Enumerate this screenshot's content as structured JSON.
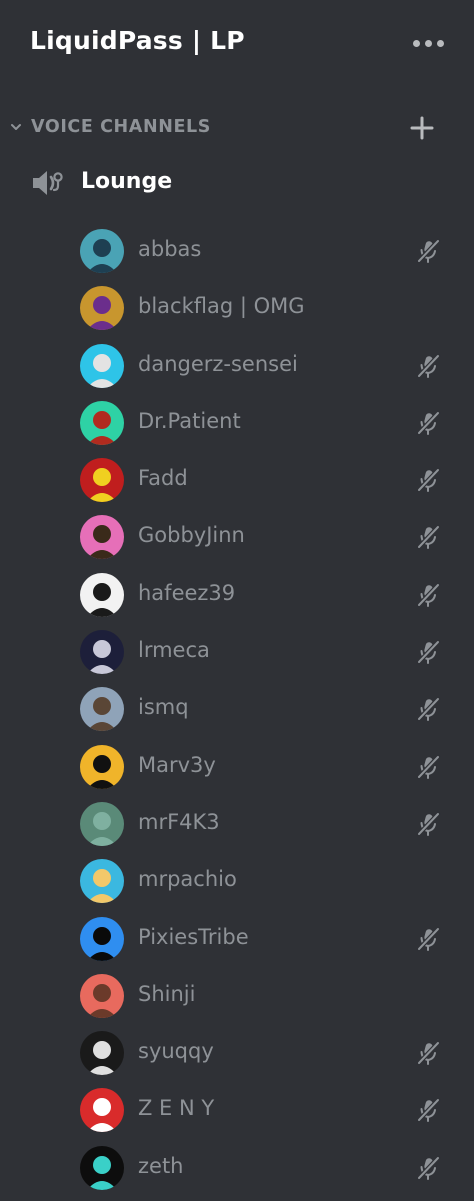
{
  "server": {
    "name": "LiquidPass | LP",
    "more_icon": "more-horizontal-icon"
  },
  "category": {
    "label": "VOICE CHANNELS",
    "collapse_icon": "chevron-down-icon",
    "add_icon": "plus-icon"
  },
  "channel": {
    "name": "Lounge",
    "icon": "speaker-icon"
  },
  "colors": {
    "background": "#2f3136",
    "title_text": "#ffffff",
    "muted_text": "#8e9297",
    "icon_gray": "#b9bbbe"
  },
  "members": [
    {
      "name": "abbas",
      "muted": true,
      "avatar_bg": "#4aa3b5",
      "avatar_fg": "#1e3f52"
    },
    {
      "name": "blackflag | OMG",
      "muted": false,
      "avatar_bg": "#c8962e",
      "avatar_fg": "#6b2e8c"
    },
    {
      "name": "dangerz-sensei",
      "muted": true,
      "avatar_bg": "#2ec4e8",
      "avatar_fg": "#e3e3e3"
    },
    {
      "name": "Dr.Patient",
      "muted": true,
      "avatar_bg": "#2ed2a5",
      "avatar_fg": "#b02b1f"
    },
    {
      "name": "Fadd",
      "muted": true,
      "avatar_bg": "#c01e1e",
      "avatar_fg": "#f0d020"
    },
    {
      "name": "GobbyJinn",
      "muted": true,
      "avatar_bg": "#e66fb8",
      "avatar_fg": "#3a2a1a"
    },
    {
      "name": "hafeez39",
      "muted": true,
      "avatar_bg": "#f2f2f2",
      "avatar_fg": "#1a1a1a"
    },
    {
      "name": "lrmeca",
      "muted": true,
      "avatar_bg": "#1d1f3a",
      "avatar_fg": "#c8c8d8"
    },
    {
      "name": "ismq",
      "muted": true,
      "avatar_bg": "#8fa3b8",
      "avatar_fg": "#5a4636"
    },
    {
      "name": "Marv3y",
      "muted": true,
      "avatar_bg": "#f0b42a",
      "avatar_fg": "#111111"
    },
    {
      "name": "mrF4K3",
      "muted": true,
      "avatar_bg": "#5a8a78",
      "avatar_fg": "#7fb0a0"
    },
    {
      "name": "mrpachio",
      "muted": false,
      "avatar_bg": "#3bb8e0",
      "avatar_fg": "#f2c86a"
    },
    {
      "name": "PixiesTribe",
      "muted": true,
      "avatar_bg": "#2f8ef0",
      "avatar_fg": "#0a0a0a"
    },
    {
      "name": "Shinji",
      "muted": false,
      "avatar_bg": "#e86a5e",
      "avatar_fg": "#6b3a2a"
    },
    {
      "name": "syuqqy",
      "muted": true,
      "avatar_bg": "#1a1a1a",
      "avatar_fg": "#e0e0e0"
    },
    {
      "name": "Z E N Y",
      "muted": true,
      "avatar_bg": "#d92b2b",
      "avatar_fg": "#ffffff"
    },
    {
      "name": "zeth",
      "muted": true,
      "avatar_bg": "#0d0d0d",
      "avatar_fg": "#3ad0c8"
    }
  ]
}
